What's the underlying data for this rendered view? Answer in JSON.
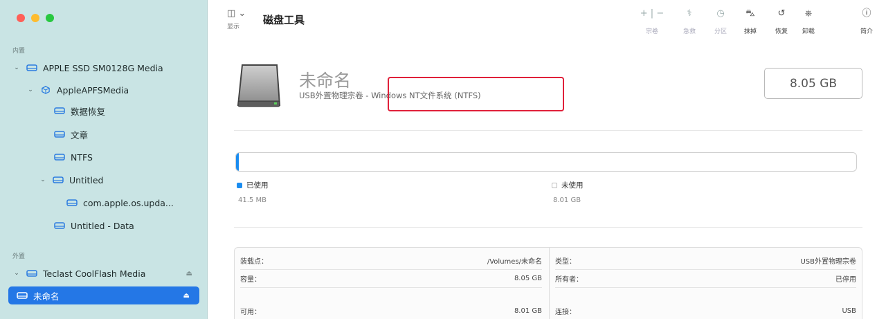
{
  "window": {
    "traffic_colors": [
      "#ff5f57",
      "#febc2e",
      "#28c840"
    ]
  },
  "sidebar": {
    "internal_label": "内置",
    "external_label": "外置",
    "items": [
      {
        "label": "APPLE SSD SM0128G Media",
        "level": 0,
        "chevron": "⌄"
      },
      {
        "label": "AppleAPFSMedia",
        "level": 1,
        "chevron": "⌄"
      },
      {
        "label": "数据恢复",
        "level": 2
      },
      {
        "label": "文章",
        "level": 2
      },
      {
        "label": "NTFS",
        "level": 2
      },
      {
        "label": "Untitled",
        "level": 2,
        "chevron": "⌄"
      },
      {
        "label": "com.apple.os.upda...",
        "level": 3
      },
      {
        "label": "Untitled - Data",
        "level": 2
      },
      {
        "label": "Teclast CoolFlash Media",
        "level": 0,
        "chevron": "⌄",
        "eject": "⏏"
      },
      {
        "label": "未命名",
        "level": 1,
        "eject": "⏏",
        "selected": true
      }
    ]
  },
  "toolbar": {
    "sidebar_icon": "◫ ⌄",
    "view_label": "显示",
    "title": "磁盘工具",
    "buttons": [
      {
        "icon": "+ | −",
        "label": "宗卷"
      },
      {
        "icon": "⚕",
        "label": "急救"
      },
      {
        "icon": "◷",
        "label": "分区"
      },
      {
        "icon": "⛍",
        "label": "抹掉"
      },
      {
        "icon": "↺",
        "label": "恢复"
      },
      {
        "icon": "⎈",
        "label": "卸载"
      },
      {
        "icon": "ⓘ",
        "label": "简介"
      }
    ]
  },
  "volume": {
    "name": "未命名",
    "description": "USB外置物理宗卷 - Windows NT文件系统 (NTFS)",
    "size": "8.05 GB"
  },
  "usage": {
    "used_fraction": 0.005,
    "used_color": "#1a8cf0",
    "used_label": "已使用",
    "used_value": "41.5 MB",
    "free_label": "未使用",
    "free_value": "8.01 GB"
  },
  "info": {
    "left": [
      {
        "key": "装载点：",
        "value": "/Volumes/未命名"
      },
      {
        "key": "容量：",
        "value": "8.05 GB"
      },
      {
        "key": "可用：",
        "value": "8.01 GB"
      }
    ],
    "right": [
      {
        "key": "类型：",
        "value": "USB外置物理宗卷"
      },
      {
        "key": "所有者：",
        "value": "已停用"
      },
      {
        "key": "连接：",
        "value": "USB"
      }
    ]
  }
}
